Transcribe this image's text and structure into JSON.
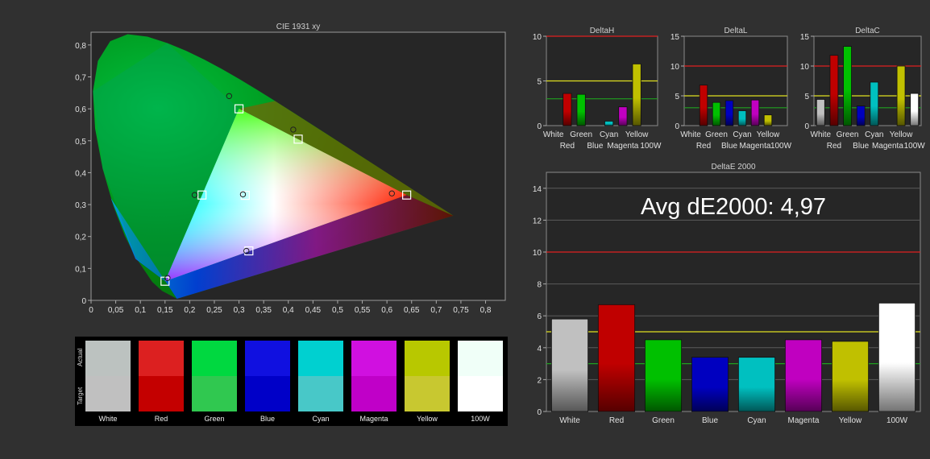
{
  "chart_data": [
    {
      "type": "scatter",
      "title": "CIE 1931 xy",
      "x_ticks": [
        "0",
        "0,05",
        "0,1",
        "0,15",
        "0,2",
        "0,25",
        "0,3",
        "0,35",
        "0,4",
        "0,45",
        "0,5",
        "0,55",
        "0,6",
        "0,65",
        "0,7",
        "0,75",
        "0,8"
      ],
      "y_ticks": [
        "0",
        "0,1",
        "0,2",
        "0,3",
        "0,4",
        "0,5",
        "0,6",
        "0,7",
        "0,8"
      ],
      "xlim": [
        0,
        0.84
      ],
      "ylim": [
        0,
        0.84
      ],
      "gamut_target": [
        [
          0.64,
          0.33
        ],
        [
          0.3,
          0.6
        ],
        [
          0.15,
          0.06
        ]
      ],
      "target_points": [
        {
          "x": 0.64,
          "y": 0.33
        },
        {
          "x": 0.3,
          "y": 0.6
        },
        {
          "x": 0.15,
          "y": 0.06
        },
        {
          "x": 0.225,
          "y": 0.33
        },
        {
          "x": 0.32,
          "y": 0.155
        },
        {
          "x": 0.42,
          "y": 0.505
        },
        {
          "x": 0.3127,
          "y": 0.329
        }
      ],
      "measured_points": [
        {
          "x": 0.61,
          "y": 0.335
        },
        {
          "x": 0.28,
          "y": 0.64
        },
        {
          "x": 0.155,
          "y": 0.07
        },
        {
          "x": 0.21,
          "y": 0.33
        },
        {
          "x": 0.315,
          "y": 0.155
        },
        {
          "x": 0.41,
          "y": 0.535
        },
        {
          "x": 0.308,
          "y": 0.332
        }
      ]
    },
    {
      "type": "bar",
      "title": "DeltaH",
      "categories": [
        "White",
        "Red",
        "Green",
        "Blue",
        "Cyan",
        "Magenta",
        "Yellow",
        "100W"
      ],
      "category_labels": [
        "White",
        "Red",
        "Green",
        "Blue",
        "Cyan",
        "Magenta",
        "Yellow",
        "100W"
      ],
      "values": [
        0,
        3.6,
        3.5,
        0,
        0.5,
        2.1,
        6.9,
        0
      ],
      "y_ticks": [
        "0",
        "5",
        "10"
      ],
      "ylim": [
        0,
        10
      ],
      "thresholds": {
        "red": 10,
        "yellow": 5,
        "green": 3
      }
    },
    {
      "type": "bar",
      "title": "DeltaL",
      "categories": [
        "White",
        "Red",
        "Green",
        "Blue",
        "Cyan",
        "Magenta",
        "Yellow",
        "100W"
      ],
      "category_labels": [
        "White",
        "Red",
        "Green",
        "Blue",
        "Cyan",
        "Magenta",
        "Yellow",
        "100W"
      ],
      "values": [
        0,
        6.8,
        3.9,
        4.2,
        2.5,
        4.3,
        1.8,
        0
      ],
      "y_ticks": [
        "0",
        "5",
        "10",
        "15"
      ],
      "ylim": [
        0,
        15
      ],
      "thresholds": {
        "red": 10,
        "yellow": 5,
        "green": 3
      }
    },
    {
      "type": "bar",
      "title": "DeltaC",
      "categories": [
        "White",
        "Red",
        "Green",
        "Blue",
        "Cyan",
        "Magenta",
        "Yellow",
        "100W"
      ],
      "category_labels": [
        "White",
        "Red",
        "Green",
        "Blue",
        "Cyan",
        "Magenta",
        "Yellow",
        "100W"
      ],
      "values": [
        4.4,
        11.8,
        13.3,
        3.3,
        7.3,
        0,
        10.0,
        5.4
      ],
      "y_ticks": [
        "0",
        "5",
        "10",
        "15"
      ],
      "ylim": [
        0,
        15
      ],
      "thresholds": {
        "red": 10,
        "yellow": 5,
        "green": 3
      }
    },
    {
      "type": "bar",
      "title": "DeltaE 2000",
      "annotation": "Avg dE2000: 4,97",
      "categories": [
        "White",
        "Red",
        "Green",
        "Blue",
        "Cyan",
        "Magenta",
        "Yellow",
        "100W"
      ],
      "category_labels": [
        "White",
        "Red",
        "Green",
        "Blue",
        "Cyan",
        "Magenta",
        "Yellow",
        "100W"
      ],
      "values": [
        5.8,
        6.7,
        4.5,
        3.4,
        3.4,
        4.5,
        4.4,
        6.8
      ],
      "y_ticks": [
        "0",
        "2",
        "4",
        "6",
        "8",
        "10",
        "12",
        "14"
      ],
      "ylim": [
        0,
        15
      ],
      "thresholds": {
        "red": 10,
        "yellow": 5,
        "green": 3
      }
    }
  ],
  "bar_colors": {
    "White": "#c0c0c0",
    "Red": "#c00000",
    "Green": "#00c000",
    "Blue": "#0000c0",
    "Cyan": "#00c0c0",
    "Magenta": "#c000c0",
    "Yellow": "#c0c000",
    "100W": "#ffffff"
  },
  "swatch_panel": {
    "label_actual": "Actual",
    "label_target": "Target",
    "items": [
      {
        "name": "White",
        "actual": "#bcc2c0",
        "target": "#c0c0c0"
      },
      {
        "name": "Red",
        "actual": "#dc2020",
        "target": "#c40000"
      },
      {
        "name": "Green",
        "actual": "#00d840",
        "target": "#30c850"
      },
      {
        "name": "Blue",
        "actual": "#1010e0",
        "target": "#0000c8"
      },
      {
        "name": "Cyan",
        "actual": "#00d0d0",
        "target": "#48c8c8"
      },
      {
        "name": "Magenta",
        "actual": "#d010e0",
        "target": "#c000c8"
      },
      {
        "name": "Yellow",
        "actual": "#b8c800",
        "target": "#c8c830"
      },
      {
        "name": "100W",
        "actual": "#f0fff8",
        "target": "#ffffff"
      }
    ]
  }
}
